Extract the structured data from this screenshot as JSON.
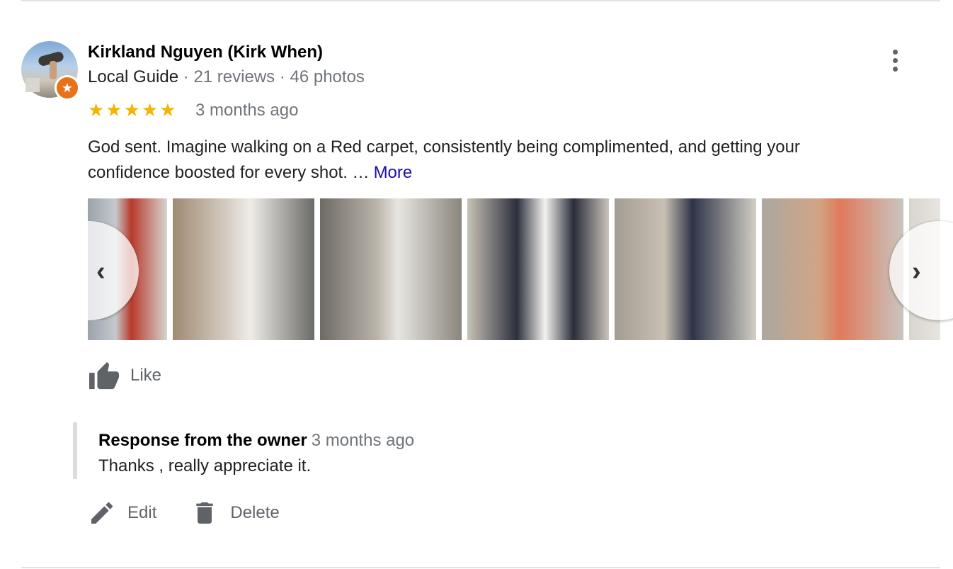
{
  "reviewer": {
    "name": "Kirkland Nguyen (Kirk When)",
    "guide_label": "Local Guide",
    "reviews": "21 reviews",
    "photos": "46 photos",
    "separator": "·",
    "badge_icon": "star-icon"
  },
  "review": {
    "rating": 5,
    "stars_text": "★★★★★",
    "time_ago": "3 months ago",
    "text": "God sent. Imagine walking on a Red carpet, consistently being complimented, and getting your confidence boosted for every shot. …",
    "more_label": "More"
  },
  "photos": {
    "count_visible": 7,
    "prev_icon": "chevron-left-icon",
    "next_icon": "chevron-right-icon",
    "prev_glyph": "‹",
    "next_glyph": "›"
  },
  "like": {
    "label": "Like",
    "icon": "thumbs-up-icon"
  },
  "owner_response": {
    "title": "Response from the owner",
    "time_ago": "3 months ago",
    "text": "Thanks , really appreciate it."
  },
  "actions": {
    "edit_label": "Edit",
    "edit_icon": "pencil-icon",
    "delete_label": "Delete",
    "delete_icon": "trash-icon"
  },
  "colors": {
    "star": "#f4b400",
    "more_link": "#1a0dab",
    "secondary_text": "#70757a",
    "badge": "#e8711c",
    "icon_gray": "#5f6368"
  }
}
